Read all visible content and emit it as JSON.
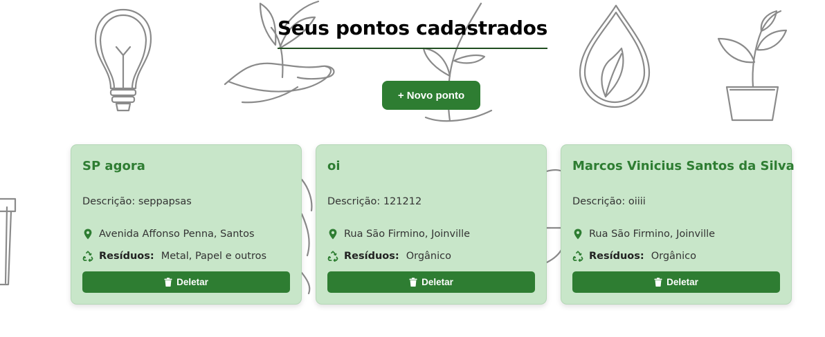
{
  "header": {
    "title": "Seus pontos cadastrados",
    "new_button_label": "+ Novo ponto"
  },
  "cards": [
    {
      "name": "SP agora",
      "description": "Descrição: seppapsas",
      "address": "Avenida Affonso Penna, Santos",
      "waste_label": "Resíduos:",
      "waste": "Metal, Papel e outros",
      "delete_label": "Deletar"
    },
    {
      "name": "oi",
      "description": "Descrição: 121212",
      "address": "Rua São Firmino, Joinville",
      "waste_label": "Resíduos:",
      "waste": "Orgânico",
      "delete_label": "Deletar"
    },
    {
      "name": "Marcos Vinicius Santos da Silva",
      "description": "Descrição: oiiii",
      "address": "Rua São Firmino, Joinville",
      "waste_label": "Resíduos:",
      "waste": "Orgânico",
      "delete_label": "Deletar"
    }
  ],
  "colors": {
    "primary": "#2e7d32",
    "card_background": "#c8e6c9",
    "background_art": "#8a8a8a"
  },
  "icons": {
    "address": "map-pin-icon",
    "waste": "recycle-icon",
    "delete": "trash-icon"
  }
}
